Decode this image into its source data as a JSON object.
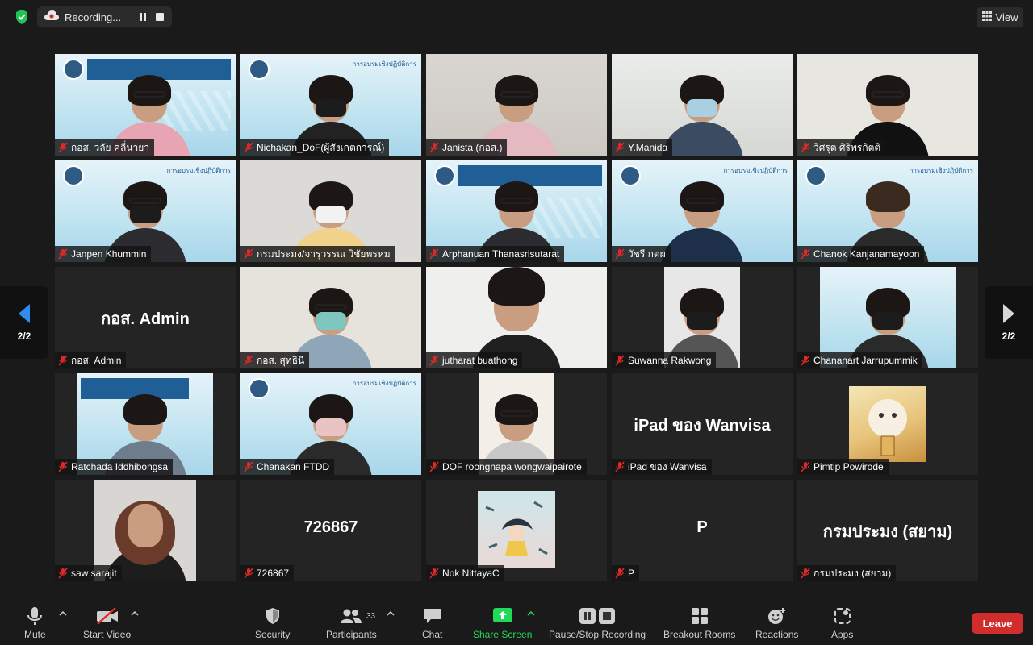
{
  "recording": {
    "label": "Recording..."
  },
  "view": {
    "label": "View"
  },
  "pager": {
    "left": "2/2",
    "right": "2/2"
  },
  "colors": {
    "share_green": "#23d959",
    "leave_red": "#d12d2d",
    "mic_off_red": "#e02828"
  },
  "participants": [
    {
      "name": "กอส. วลัย คลี่นายา",
      "video": "slide"
    },
    {
      "name": "Nichakan_DoF(ผู้สังเกตการณ์)",
      "video": "slide"
    },
    {
      "name": "Janista  (กอส.)",
      "video": "room"
    },
    {
      "name": "Y.Manida",
      "video": "shelf"
    },
    {
      "name": "วิศรุต ศิริพรกิตติ",
      "video": "shelf"
    },
    {
      "name": "Janpen Khummin",
      "video": "slide"
    },
    {
      "name": "กรมประมง/จารุวรรณ วิชัยพรหม",
      "video": "room"
    },
    {
      "name": "Arphanuan Thanasrisutarat",
      "video": "slide"
    },
    {
      "name": "วัชรี  กตผ",
      "video": "slide"
    },
    {
      "name": "Chanok Kanjanamayoon",
      "video": "slide"
    },
    {
      "name": "กอส. Admin",
      "video": "none",
      "display": "กอส. Admin"
    },
    {
      "name": "กอส. สุทธินี",
      "video": "shelf"
    },
    {
      "name": "jutharat buathong",
      "video": "room"
    },
    {
      "name": "Suwanna Rakwong",
      "video": "room"
    },
    {
      "name": "Chananart Jarrupummik",
      "video": "slide"
    },
    {
      "name": "Ratchada Iddhibongsa",
      "video": "slide"
    },
    {
      "name": "Chanakan FTDD",
      "video": "slide"
    },
    {
      "name": "DOF roongnapa wongwaipairote",
      "video": "room"
    },
    {
      "name": "iPad ของ Wanvisa",
      "video": "none",
      "display": "iPad ของ Wanvisa"
    },
    {
      "name": "Pimtip Powirode",
      "video": "avatar"
    },
    {
      "name": "saw sarajit",
      "video": "room"
    },
    {
      "name": "726867",
      "video": "none",
      "display": "726867"
    },
    {
      "name": "Nok NittayaC",
      "video": "avatar"
    },
    {
      "name": "P",
      "video": "none",
      "display": "P"
    },
    {
      "name": "กรมประมง (สยาม)",
      "video": "none",
      "display": "กรมประมง (สยาม)"
    }
  ],
  "toolbar": {
    "mute": "Mute",
    "start_video": "Start Video",
    "security": "Security",
    "participants": "Participants",
    "participants_count": "33",
    "chat": "Chat",
    "share_screen": "Share Screen",
    "pause_stop_recording": "Pause/Stop Recording",
    "breakout_rooms": "Breakout Rooms",
    "reactions": "Reactions",
    "apps": "Apps",
    "leave": "Leave"
  }
}
